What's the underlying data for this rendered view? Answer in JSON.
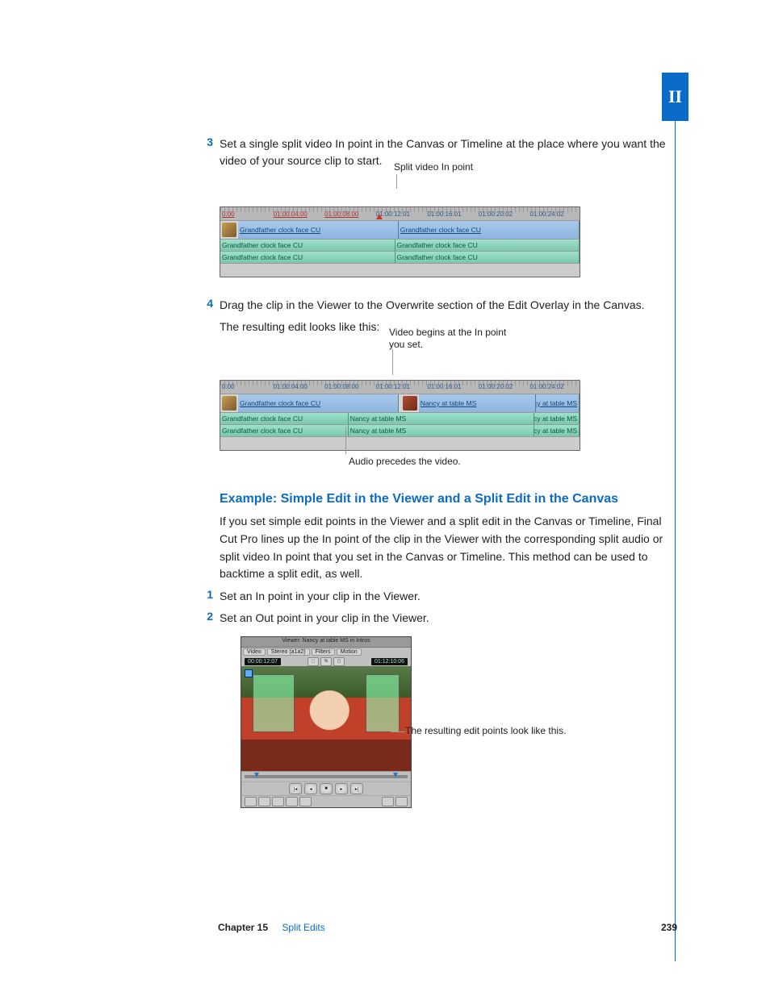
{
  "side_tab": "II",
  "step3": {
    "num": "3",
    "text": "Set a single split video In point in the Canvas or Timeline at the place where you want the video of your source clip to start."
  },
  "fig1": {
    "callout": "Split video In point",
    "ruler": [
      "0:00",
      "01:00:04:00",
      "01:00:08:00",
      "01:00:12:01",
      "01:00:16:01",
      "01:00:20:02",
      "01:00:24:02"
    ],
    "vclip_left": "Grandfather clock face CU",
    "vclip_right": "Grandfather clock face CU",
    "aclip1_left": "Grandfather clock face CU",
    "aclip1_right": "Grandfather clock face CU",
    "aclip2_left": "Grandfather clock face CU",
    "aclip2_right": "Grandfather clock face CU"
  },
  "step4": {
    "num": "4",
    "text": "Drag the clip in the Viewer to the Overwrite section of the Edit Overlay in the Canvas."
  },
  "para_result": "The resulting edit looks like this:",
  "fig2": {
    "callout_top": "Video begins at the In point you set.",
    "callout_bottom": "Audio precedes the video.",
    "ruler": [
      "0:00",
      "01:00:04:00",
      "01:00:08:00",
      "01:00:12:01",
      "01:00:16:01",
      "01:00:20:02",
      "01:00:24:02"
    ],
    "v_left": "Grandfather clock face CU",
    "v_mid": "Nancy at table MS",
    "v_right": "Nancy at table MS",
    "a1_left": "Grandfather clock face CU",
    "a1_mid": "Nancy at table MS",
    "a1_right": "Nancy at table MS",
    "a2_left": "Grandfather clock face CU",
    "a2_mid": "Nancy at table MS",
    "a2_right": "Nancy at table MS"
  },
  "heading": "Example:  Simple Edit in the Viewer and a Split Edit in the Canvas",
  "intro": "If you set simple edit points in the Viewer and a split edit in the Canvas or Timeline, Final Cut Pro lines up the In point of the clip in the Viewer with the corresponding split audio or split video In point that you set in the Canvas or Timeline. This method can be used to backtime a split edit, as well.",
  "step1": {
    "num": "1",
    "text": "Set an In point in your clip in the Viewer."
  },
  "step2": {
    "num": "2",
    "text": "Set an Out point in your clip in the Viewer."
  },
  "viewer": {
    "title": "Viewer: Nancy at table MS in Intros",
    "tabs": [
      "Video",
      "Stereo (a1a2)",
      "Filters",
      "Motion"
    ],
    "tc_left": "00:00:12:07",
    "tc_right": "01:12:10:06",
    "callout": "The resulting edit points look like this."
  },
  "footer": {
    "chapter_label": "Chapter 15",
    "chapter_title": "Split Edits",
    "page": "239"
  }
}
